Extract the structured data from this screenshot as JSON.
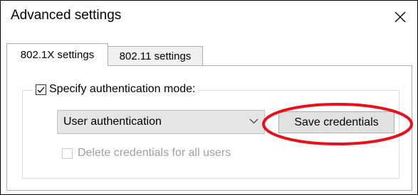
{
  "window": {
    "title": "Advanced settings",
    "close_icon": "close-icon"
  },
  "tabs": [
    {
      "label": "802.1X settings",
      "active": true
    },
    {
      "label": "802.11 settings",
      "active": false
    }
  ],
  "auth_group": {
    "checkbox_checked": true,
    "label": "Specify authentication mode:",
    "mode_select": {
      "selected": "User authentication",
      "arrow_icon": "chevron-down-icon"
    },
    "save_credentials_label": "Save credentials",
    "delete_credentials": {
      "label": "Delete credentials for all users",
      "checked": false,
      "enabled": false
    }
  },
  "annotation": {
    "shape": "ellipse",
    "color": "#e8101a",
    "highlights": "save-credentials-button"
  }
}
